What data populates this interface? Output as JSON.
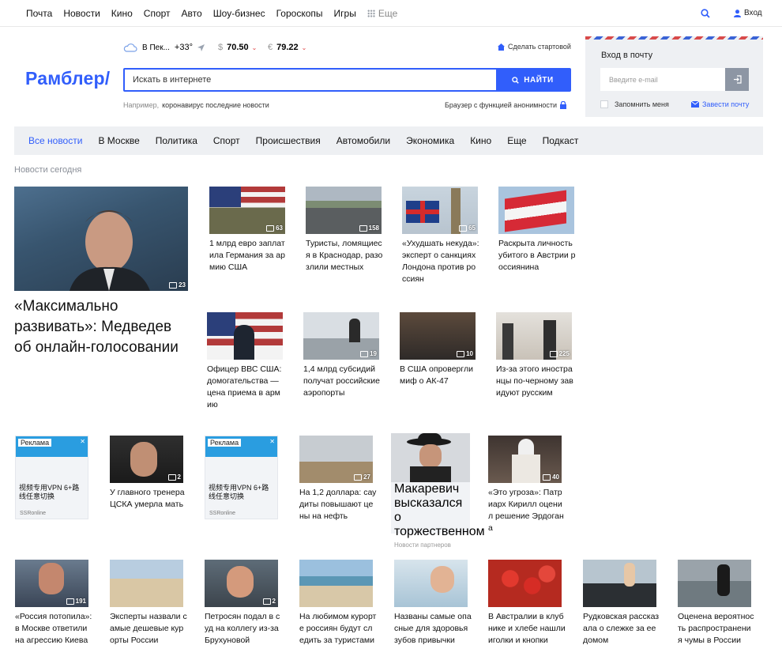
{
  "top_nav": {
    "links": [
      "Почта",
      "Новости",
      "Кино",
      "Спорт",
      "Авто",
      "Шоу-бизнес",
      "Гороскопы",
      "Игры"
    ],
    "more_label": "Еще",
    "login_label": "Вход"
  },
  "header": {
    "logo": "Рамблер/",
    "weather_city": "В Пек...",
    "weather_temp": "+33°",
    "usd_symbol": "$",
    "usd_rate": "70.50",
    "eur_symbol": "€",
    "eur_rate": "79.22",
    "make_home": "Сделать стартовой",
    "search_placeholder": "Искать в интернете",
    "search_button": "НАЙТИ",
    "hint_label": "Например,",
    "hint_text": "коронавирус последние новости",
    "anon_browser": "Браузер с функцией анонимности"
  },
  "mail": {
    "title": "Вход в почту",
    "email_placeholder": "Введите e-mail",
    "remember": "Запомнить меня",
    "create": "Завести почту"
  },
  "categories": [
    "Все новости",
    "В Москве",
    "Политика",
    "Спорт",
    "Происшествия",
    "Автомобили",
    "Экономика",
    "Кино",
    "Еще",
    "Подкаст"
  ],
  "section_title": "Новости сегодня",
  "hero": {
    "title": "«Максимально развивать»: Медведев об онлайн-голосовании",
    "count": "23"
  },
  "row1": [
    {
      "title": "1 млрд евро заплатила Германия за армию США",
      "count": "63"
    },
    {
      "title": "Туристы, ломящиеся в Краснодар, разозлили местных",
      "count": "158"
    },
    {
      "title": "«Ухудшать некуда»: эксперт о санкциях Лондона против россиян",
      "count": "65"
    },
    {
      "title": "Раскрыта личность убитого в Австрии россиянина",
      "count": ""
    }
  ],
  "row2": [
    {
      "title": "Офицер ВВС США: домогательства — цена приема в армию",
      "count": ""
    },
    {
      "title": "1,4 млрд субсидий получат российские аэропорты",
      "count": "19"
    },
    {
      "title": "В США опровергли миф о АК-47",
      "count": "10"
    },
    {
      "title": "Из-за этого иностранцы по-черному завидуют русским",
      "count": "225"
    }
  ],
  "row3": [
    {
      "title": "У главного тренера ЦСКА умерла мать",
      "count": "2"
    },
    {
      "title": "На 1,2 доллара: саудиты повышают цены на нефть",
      "count": "27"
    },
    {
      "title": "«Это угроза»: Патриарх Кирилл оценил решение Эрдогана",
      "count": "40"
    }
  ],
  "ads": [
    {
      "label": "Реклама",
      "text": "视频专用VPN 6+路线任意切换",
      "source": "SSRonline"
    },
    {
      "label": "Реклама",
      "text": "视频专用VPN 6+路线任意切换",
      "source": "SSRonline"
    }
  ],
  "partner": {
    "title": "Макаревич высказался о торжественном",
    "source": "Новости партнеров"
  },
  "row4": [
    {
      "title": "«Россия потопила»: в Москве ответили на агрессию Киева",
      "count": "191"
    },
    {
      "title": "Эксперты назвали самые дешевые курорты России",
      "count": ""
    },
    {
      "title": "Петросян подал в суд на коллегу из-за Брухуновой",
      "count": "2"
    },
    {
      "title": "На любимом курорте россиян будут следить за туристами",
      "count": ""
    },
    {
      "title": "Названы самые опасные для здоровья зубов привычки",
      "count": ""
    },
    {
      "title": "В Австралии в клубнике и хлебе нашли иголки и кнопки",
      "count": ""
    },
    {
      "title": "Рудковская рассказала о слежке за ее домом",
      "count": ""
    },
    {
      "title": "Оценена вероятность распространения чумы в России",
      "count": ""
    }
  ]
}
